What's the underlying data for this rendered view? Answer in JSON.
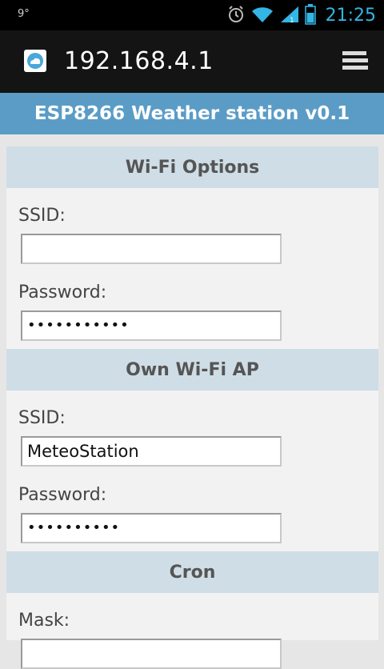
{
  "statusbar": {
    "temperature": "9°",
    "time": "21:25"
  },
  "browser": {
    "url": "192.168.4.1"
  },
  "page": {
    "title": "ESP8266 Weather station v0.1"
  },
  "sections": [
    {
      "title": "Wi-Fi Options",
      "fields": [
        {
          "label": "SSID:",
          "value": ""
        },
        {
          "label": "Password:",
          "value": "•••••••••••"
        }
      ]
    },
    {
      "title": "Own Wi-Fi AP",
      "fields": [
        {
          "label": "SSID:",
          "value": "MeteoStation"
        },
        {
          "label": "Password:",
          "value": "••••••••••"
        }
      ]
    },
    {
      "title": "Cron",
      "fields": [
        {
          "label": "Mask:",
          "value": ""
        }
      ]
    }
  ],
  "icons": {
    "alarm": "alarm-icon",
    "wifi": "wifi-icon",
    "signal": "signal-icon",
    "battery": "battery-icon",
    "app": "weather-app-icon",
    "menu": "menu-icon"
  },
  "colors": {
    "accent": "#33b5e5",
    "header": "#5b9cc6",
    "section": "#cfdde6"
  }
}
